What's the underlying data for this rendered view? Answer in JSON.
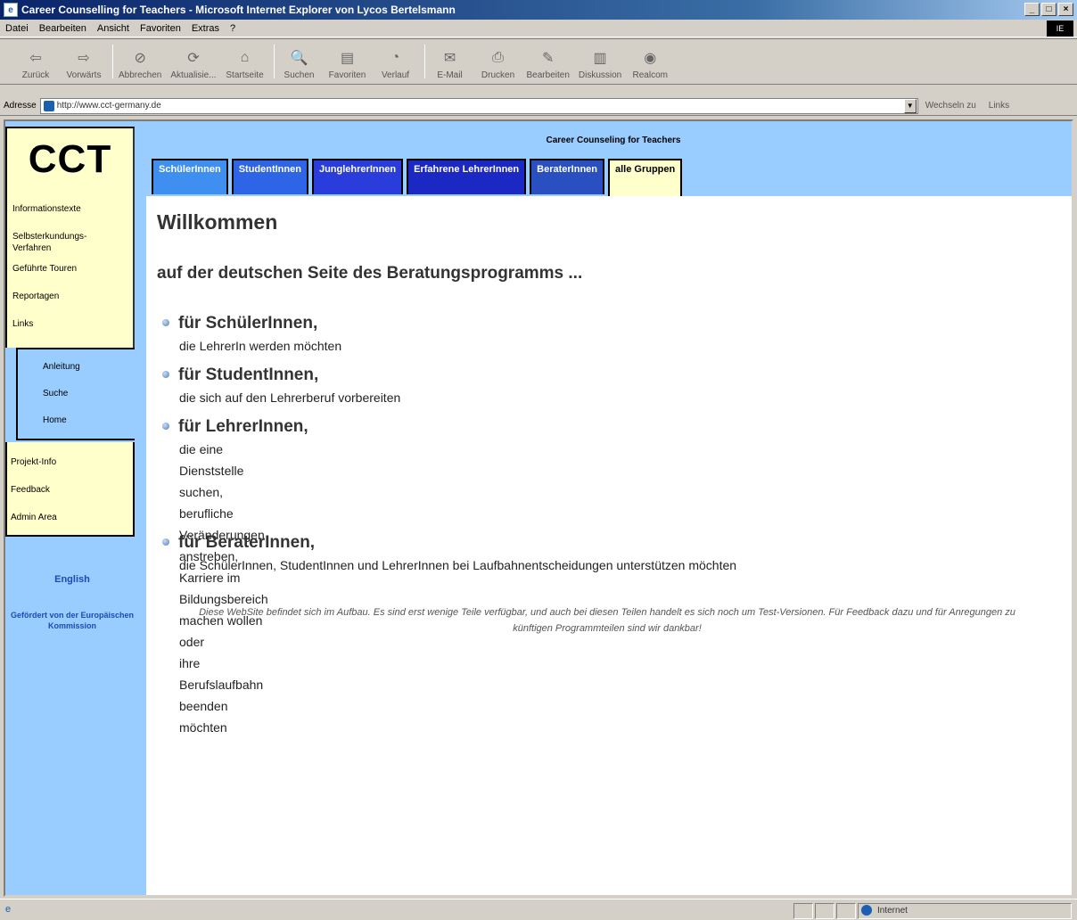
{
  "window": {
    "title": "Career Counselling for Teachers - Microsoft Internet Explorer von Lycos Bertelsmann",
    "min": "_",
    "max": "□",
    "close": "×",
    "throbber": "IE"
  },
  "menu": [
    "Datei",
    "Bearbeiten",
    "Ansicht",
    "Favoriten",
    "Extras",
    "?"
  ],
  "toolbar": [
    {
      "label": "Zurück",
      "icon": "⇦"
    },
    {
      "label": "Vorwärts",
      "icon": "⇨"
    },
    {
      "label": "Abbrechen",
      "icon": "⊘"
    },
    {
      "label": "Aktualisie...",
      "icon": "⟳"
    },
    {
      "label": "Startseite",
      "icon": "⌂"
    },
    {
      "label": "Suchen",
      "icon": "🔍"
    },
    {
      "label": "Favoriten",
      "icon": "▤"
    },
    {
      "label": "Verlauf",
      "icon": "◔"
    },
    {
      "label": "E-Mail",
      "icon": "✉"
    },
    {
      "label": "Drucken",
      "icon": "⎙"
    },
    {
      "label": "Bearbeiten",
      "icon": "✎"
    },
    {
      "label": "Diskussion",
      "icon": "▥"
    },
    {
      "label": "Realcom",
      "icon": "◉"
    }
  ],
  "address": {
    "label": "Adresse",
    "url": "http://www.cct-germany.de",
    "go": "Wechseln zu",
    "links": "Links"
  },
  "sidebar": {
    "logo": "CCT",
    "nav": [
      "Informationstexte",
      "Selbsterkundungs-\nVerfahren",
      "Geführte Touren",
      "Reportagen",
      "Links"
    ],
    "sub": [
      "Anleitung",
      "Suche",
      "Home"
    ],
    "project": [
      "Projekt-Info",
      "Feedback",
      "Admin Area"
    ],
    "english": "English",
    "funded": "Gefördert von der Europäischen Kommission"
  },
  "header": {
    "title": "Career Counseling for Teachers",
    "tabs": [
      {
        "label": "SchülerInnen",
        "color": "#3f8ff0"
      },
      {
        "label": "StudentInnen",
        "color": "#2e64e6"
      },
      {
        "label": "JunglehrerInnen",
        "color": "#2a3ddc"
      },
      {
        "label": "Erfahrene LehrerInnen",
        "color": "#1c28c4"
      },
      {
        "label": "BeraterInnen",
        "color": "#2a4fc0"
      },
      {
        "label": "alle Gruppen",
        "color": "#ffffcc"
      }
    ]
  },
  "content": {
    "welcome": "Willkommen",
    "subtitle": "auf der deutschen Seite des Beratungsprogramms ...",
    "groups": [
      {
        "title": "für SchülerInnen,",
        "desc": "die LehrerIn werden möchten"
      },
      {
        "title": "für StudentInnen,",
        "desc": "die sich auf den Lehrerberuf vorbereiten"
      },
      {
        "title": "für LehrerInnen,",
        "desc": "die eine Dienststelle suchen,\nberufliche Veränderungen anstreben,\nKarriere im Bildungsbereich machen wollen oder\nihre Berufslaufbahn beenden möchten"
      },
      {
        "title": "für BeraterInnen,",
        "desc": "die SchülerInnen, StudentInnen und LehrerInnen bei Laufbahnentscheidungen unterstützen möchten"
      }
    ],
    "notice": "Diese WebSite befindet sich im Aufbau. Es sind erst wenige Teile verfügbar, und auch bei diesen Teilen handelt es sich noch um Test-Versionen. Für Feedback dazu und für Anregungen zu künftigen Programmteilen sind wir dankbar!"
  },
  "status": {
    "zone": "Internet"
  }
}
